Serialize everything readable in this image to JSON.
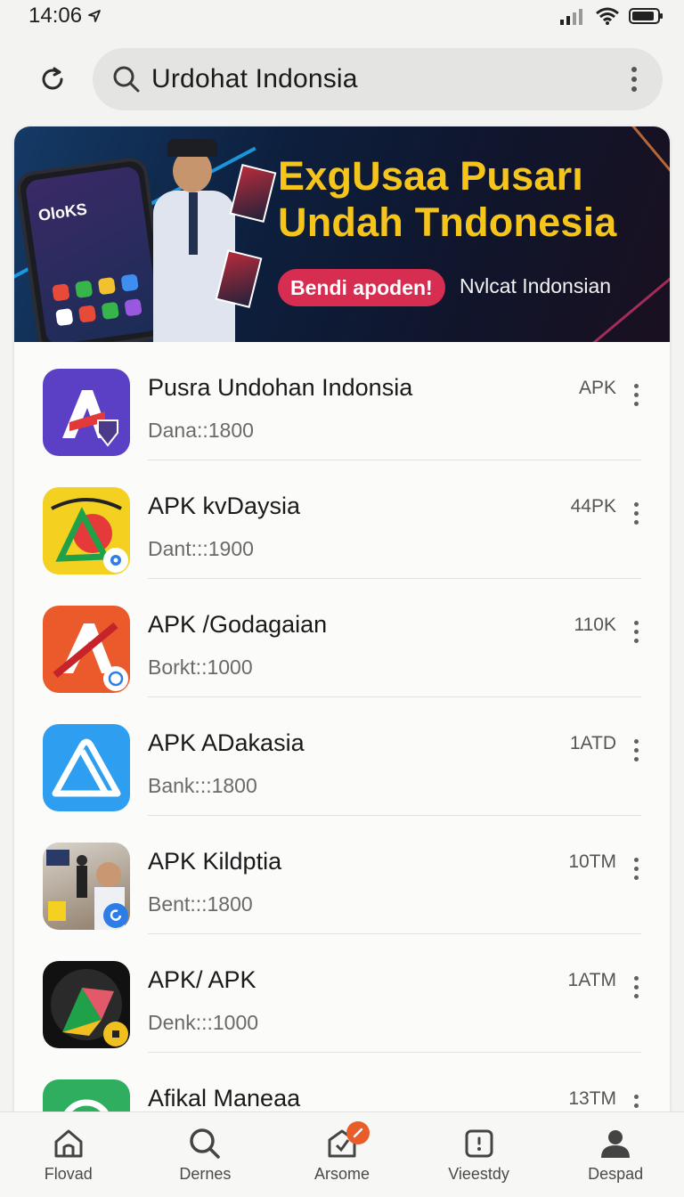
{
  "status_bar": {
    "time": "14:06"
  },
  "search": {
    "query": "Urdohat Indonsia"
  },
  "banner": {
    "title_line1": "ExgUsaa Pusarı",
    "title_line2": "Undah Tndonesia",
    "cta_label": "Bendi apoden!",
    "subtitle": "Nvlcat Indonsian",
    "phone_text": "OloKS",
    "colors": {
      "title": "#f5c51c",
      "cta": "#d62d50"
    }
  },
  "apps": [
    {
      "name": "Pusra Undohan Indonsia",
      "meta": "Dana::1800",
      "badge": "APK",
      "icon": "shield-a-icon",
      "color": "#5b3fc4"
    },
    {
      "name": "APK kvDaysia",
      "meta": "Dant:::1900",
      "badge": "44PK",
      "icon": "triangle-play-icon",
      "color": "#f4d020"
    },
    {
      "name": "APK /Godagaian",
      "meta": "Borkt::1000",
      "badge": "110K",
      "icon": "crossed-a-icon",
      "color": "#ea5a2a"
    },
    {
      "name": "APK ADakasia",
      "meta": "Bank:::1800",
      "badge": "1ATD",
      "icon": "triangle-outline-icon",
      "color": "#2e9ff0"
    },
    {
      "name": "APK Kildptia",
      "meta": "Bent:::1800",
      "badge": "10TM",
      "icon": "people-photo-icon",
      "color": "#8c7a66"
    },
    {
      "name": "APK/ APK",
      "meta": "Denk:::1000",
      "badge": "1ATM",
      "icon": "play-triangle-icon",
      "color": "#111111"
    },
    {
      "name": "Afikal Maneaa",
      "meta": "",
      "badge": "13TM",
      "icon": "green-circle-icon",
      "color": "#2fae5f"
    }
  ],
  "nav": [
    {
      "label": "Flovad",
      "icon": "home-icon"
    },
    {
      "label": "Dernes",
      "icon": "search-icon"
    },
    {
      "label": "Arsome",
      "icon": "updates-icon"
    },
    {
      "label": "Vieestdy",
      "icon": "downloads-icon"
    },
    {
      "label": "Despad",
      "icon": "profile-icon"
    }
  ]
}
